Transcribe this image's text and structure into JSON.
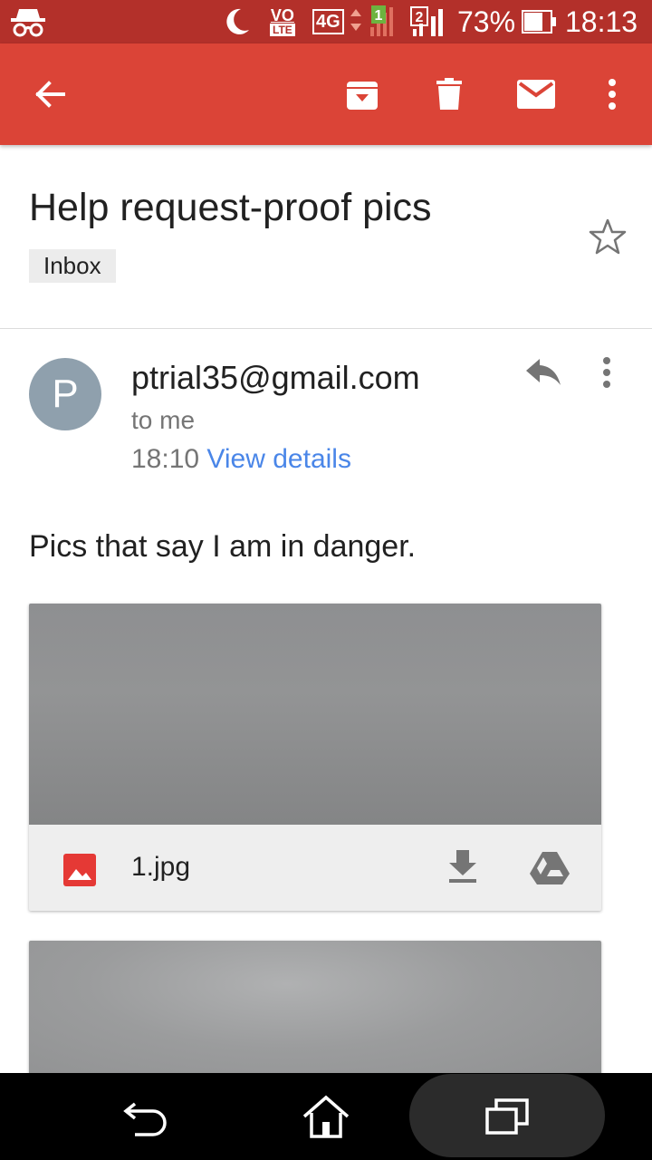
{
  "status_bar": {
    "volte": "VO",
    "lte": "LTE",
    "network": "4G",
    "sim1": "1",
    "sim2": "2",
    "battery": "73%",
    "time": "18:13"
  },
  "toolbar": {
    "icons": [
      "back-arrow-icon",
      "archive-icon",
      "delete-icon",
      "mark-unread-icon",
      "more-vert-icon"
    ]
  },
  "email": {
    "subject": "Help request-proof pics",
    "label": "Inbox",
    "sender_initial": "P",
    "sender": "ptrial35@gmail.com",
    "recipient": "to me",
    "time": "18:10",
    "view_details": "View details",
    "body": "Pics that say I am in danger."
  },
  "attachments": [
    {
      "name": "1.jpg",
      "type_icon": "image-icon",
      "actions": [
        "download-icon",
        "save-to-drive-icon"
      ]
    }
  ],
  "nav_bar": {
    "icons": [
      "back-icon",
      "home-icon",
      "recents-icon"
    ]
  },
  "colors": {
    "status_bar": "#b3302a",
    "app_bar": "#db4437",
    "link": "#4a86e8",
    "avatar": "#8fa0ad"
  }
}
